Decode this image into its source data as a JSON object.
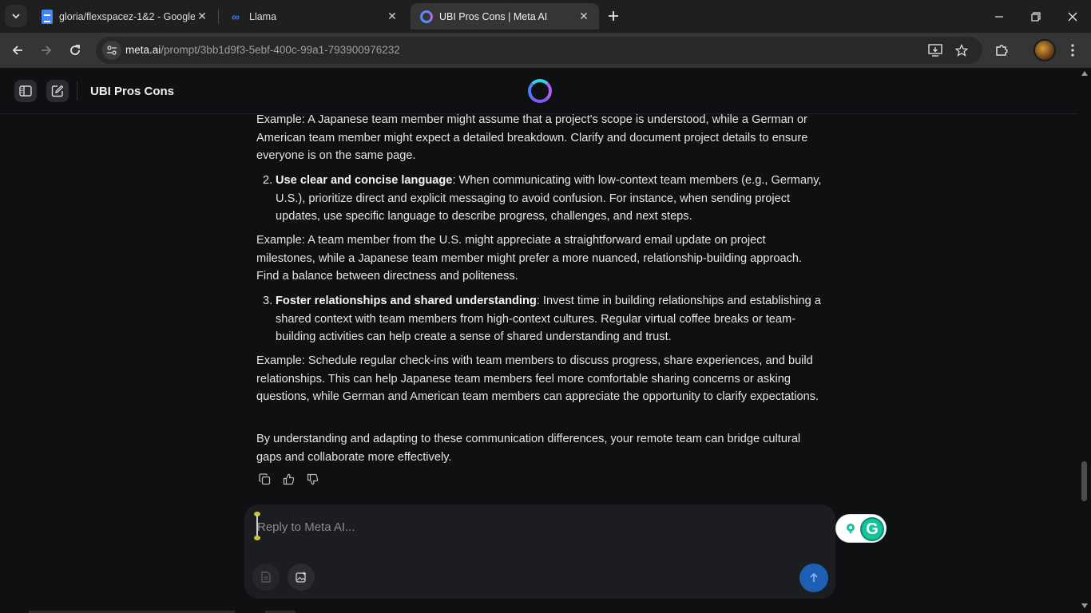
{
  "browser": {
    "tabs": [
      {
        "title": "gloria/flexspacez-1&2 - Google",
        "favicon": "google-docs-icon",
        "active": false
      },
      {
        "title": "Llama",
        "favicon": "meta-icon",
        "active": false
      },
      {
        "title": "UBI Pros Cons | Meta AI",
        "favicon": "meta-ai-icon",
        "active": true
      }
    ],
    "address": {
      "host": "meta.ai",
      "path": "/prompt/3bb1d9f3-5ebf-400c-99a1-793900976232"
    }
  },
  "header": {
    "title": "UBI Pros Cons"
  },
  "conversation": {
    "para1": "Example: A Japanese team member might assume that a project's scope is understood, while a German or American team member might expect a detailed breakdown. Clarify and document project details to ensure everyone is on the same page.",
    "item2": {
      "num": "2.",
      "bold": "Use clear and concise language",
      "rest": ": When communicating with low-context team members (e.g., Germany, U.S.), prioritize direct and explicit messaging to avoid confusion. For instance, when sending project updates, use specific language to describe progress, challenges, and next steps."
    },
    "para2": "Example: A team member from the U.S. might appreciate a straightforward email update on project milestones, while a Japanese team member might prefer a more nuanced, relationship-building approach. Find a balance between directness and politeness.",
    "item3": {
      "num": "3.",
      "bold": "Foster relationships and shared understanding",
      "rest": ": Invest time in building relationships and establishing a shared context with team members from high-context cultures. Regular virtual coffee breaks or team-building activities can help create a sense of shared understanding and trust."
    },
    "para3": "Example: Schedule regular check-ins with team members to discuss progress, share experiences, and build relationships. This can help Japanese team members feel more comfortable sharing concerns or asking questions, while German and American team members can appreciate the opportunity to clarify expectations.",
    "para4": "By understanding and adapting to these communication differences, your remote team can bridge cultural gaps and collaborate more effectively."
  },
  "composer": {
    "placeholder": "Reply to Meta AI..."
  },
  "colors": {
    "background": "#0f1012",
    "send": "#1e5fb4",
    "grammarly": "#15c39a"
  }
}
